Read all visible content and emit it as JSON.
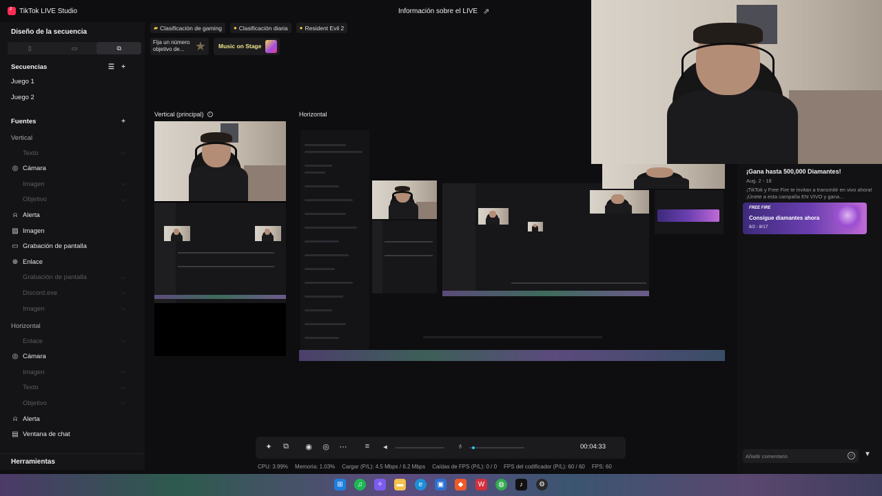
{
  "app": {
    "title": "TikTok LIVE Studio",
    "live_info": "Información sobre el LIVE",
    "accent": "#fe2c55"
  },
  "sidebar": {
    "header": "Diseño de la secuencia",
    "scenes_title": "Secuencias",
    "scenes": [
      "Juego 1",
      "Juego 2"
    ],
    "sources_title": "Fuentes",
    "vertical_title": "Vertical",
    "vertical_sources": [
      {
        "label": "Texto",
        "icon": "text-icon",
        "dim": true
      },
      {
        "label": "Cámara",
        "icon": "camera-icon",
        "dim": false
      },
      {
        "label": "Imagen",
        "icon": "image-icon",
        "dim": true
      },
      {
        "label": "Objetivo",
        "icon": "goal-icon",
        "dim": true
      },
      {
        "label": "Alerta",
        "icon": "bell-icon",
        "dim": false
      },
      {
        "label": "Imagen",
        "icon": "image-icon",
        "dim": false
      },
      {
        "label": "Grabación de pantalla",
        "icon": "monitor-icon",
        "dim": false
      },
      {
        "label": "Enlace",
        "icon": "globe-icon",
        "dim": false
      },
      {
        "label": "Grabación de pantalla",
        "icon": "monitor-icon",
        "dim": true
      },
      {
        "label": "Discord.exe",
        "icon": "window-icon",
        "dim": true
      },
      {
        "label": "Imagen",
        "icon": "image-icon",
        "dim": true
      }
    ],
    "horizontal_title": "Horizontal",
    "horizontal_sources": [
      {
        "label": "Enlace",
        "icon": "globe-icon",
        "dim": true
      },
      {
        "label": "Cámara",
        "icon": "camera-icon",
        "dim": false
      },
      {
        "label": "Imagen",
        "icon": "image-icon",
        "dim": true
      },
      {
        "label": "Texto",
        "icon": "text-icon",
        "dim": true
      },
      {
        "label": "Objetivo",
        "icon": "goal-icon",
        "dim": true
      },
      {
        "label": "Alerta",
        "icon": "bell-icon",
        "dim": false
      },
      {
        "label": "Ventana de chat",
        "icon": "chat-icon",
        "dim": false
      }
    ],
    "tools": "Herramientas"
  },
  "chips": [
    {
      "label": "Clasificación de gaming"
    },
    {
      "label": "Clasificación diaria"
    },
    {
      "label": "Resident Evil 2"
    }
  ],
  "goal_card": {
    "text": "Fija un número objetivo de..."
  },
  "stage_card": {
    "text": "Music on Stage"
  },
  "previews": {
    "vertical_label": "Vertical (principal)",
    "horizontal_label": "Horizontal"
  },
  "chat_panel": {
    "promo_title": "¡Gana hasta 500,000 Diamantes!",
    "promo_date": "Aug. 2 - 18",
    "promo_desc": "¡TikTok y Free Fire te invitan a transmitir en vivo ahora! ¡Únete a esta campaña EN VIVO y gana...",
    "promo_brand": "FREE FIRE",
    "promo_cta": "Consigue diamantes ahora",
    "promo_dates": "8/2 - 8/17",
    "comment_placeholder": "Añadir comentario"
  },
  "controls": {
    "timer": "00:04:33",
    "mic_level": 0.05
  },
  "stats": {
    "cpu": "CPU: 3.99%",
    "memory": "Memoria: 1.03%",
    "upload": "Cargar (P/L): 4.5 Mbps / 6.2 Mbps",
    "fps_drop": "Caídas de FPS (P/L): 0 / 0",
    "encoder_fps": "FPS del codificador (P/L): 60 / 60",
    "fps": "FPS: 60"
  }
}
